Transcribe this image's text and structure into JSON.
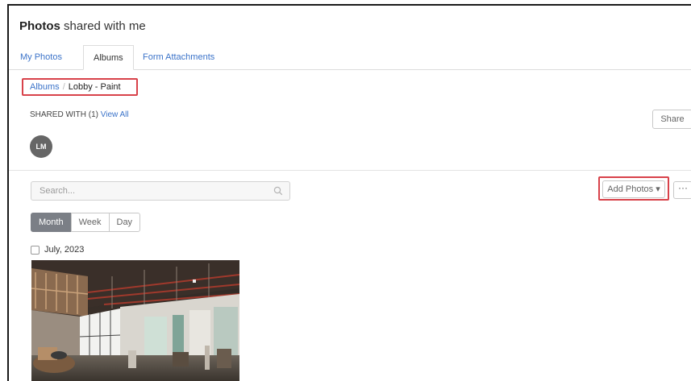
{
  "header": {
    "title_bold": "Photos",
    "title_rest": " shared with me"
  },
  "tabs": [
    {
      "label": "My Photos",
      "active": false
    },
    {
      "label": "Albums",
      "active": true
    },
    {
      "label": "Form Attachments",
      "active": false
    }
  ],
  "breadcrumb": {
    "root": "Albums",
    "separator": "/",
    "current": "Lobby - Paint"
  },
  "shared": {
    "label": "SHARED WITH (1)",
    "view_all": "View All",
    "share_button": "Share",
    "avatar_initials": "LM"
  },
  "toolbar": {
    "search_placeholder": "Search...",
    "add_photos_label": "Add Photos ▾",
    "more_label": "···"
  },
  "view_toggle": {
    "month": "Month",
    "week": "Week",
    "day": "Day",
    "selected": "Month"
  },
  "groups": [
    {
      "date_label": "July, 2023"
    }
  ],
  "colors": {
    "link": "#3b73c9",
    "highlight": "#d8424a",
    "active_segment": "#7b7f86"
  }
}
